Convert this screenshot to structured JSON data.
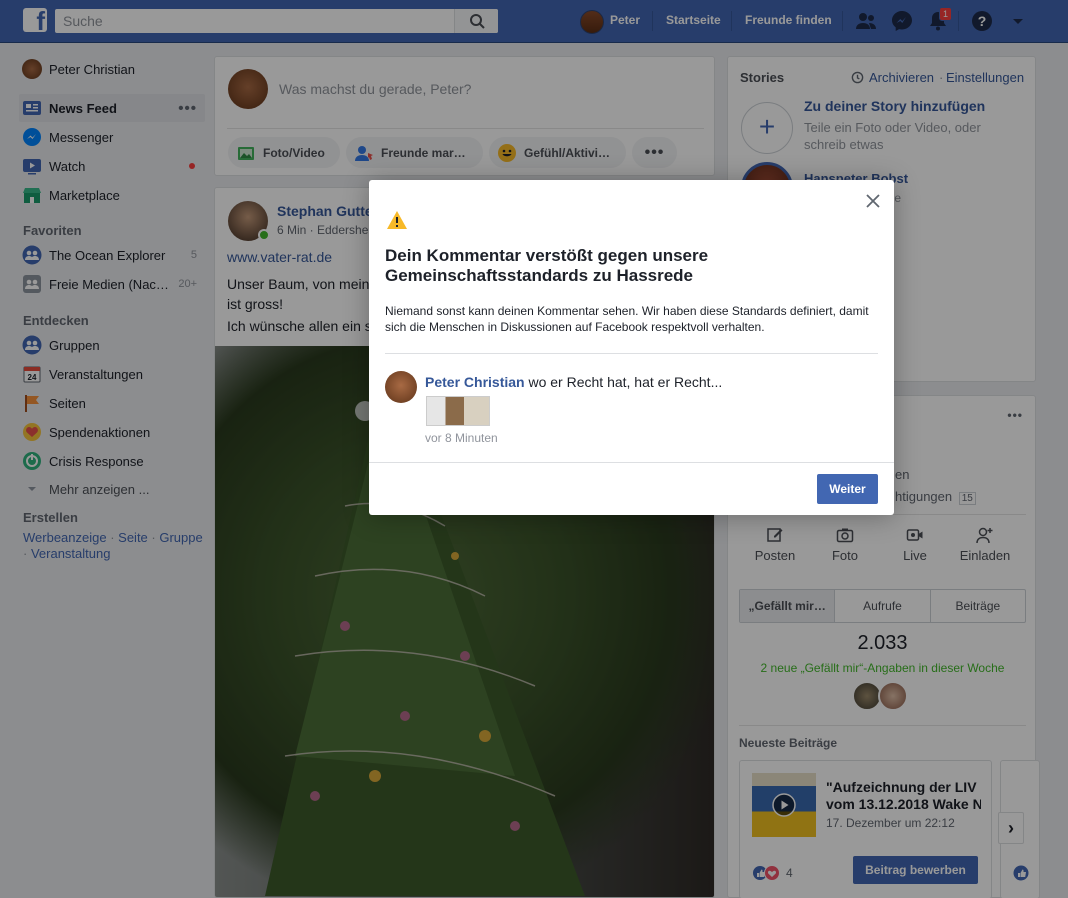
{
  "topbar": {
    "logo": "f",
    "search_placeholder": "Suche",
    "user_name": "Peter",
    "links": [
      "Startseite",
      "Freunde finden"
    ],
    "notif_count": "1"
  },
  "left": {
    "profile_name": "Peter Christian",
    "nav": [
      {
        "label": "News Feed",
        "icon": "news-feed-icon"
      },
      {
        "label": "Messenger",
        "icon": "messenger-icon"
      },
      {
        "label": "Watch",
        "icon": "watch-icon"
      },
      {
        "label": "Marketplace",
        "icon": "marketplace-icon"
      }
    ],
    "favorites_head": "Favoriten",
    "favorites": [
      {
        "label": "The Ocean Explorer",
        "count": "5"
      },
      {
        "label": "Freie Medien (Nac…",
        "count": "20+"
      }
    ],
    "discover_head": "Entdecken",
    "discover": [
      {
        "label": "Gruppen",
        "icon": "groups-icon"
      },
      {
        "label": "Veranstaltungen",
        "icon": "calendar-icon"
      },
      {
        "label": "Seiten",
        "icon": "flag-icon"
      },
      {
        "label": "Spendenaktionen",
        "icon": "heart-icon"
      },
      {
        "label": "Crisis Response",
        "icon": "crisis-icon"
      }
    ],
    "more_label": "Mehr anzeigen ...",
    "create_head": "Erstellen",
    "create_links": [
      "Werbeanzeige",
      "Seite",
      "Gruppe",
      "Veranstaltung"
    ]
  },
  "composer": {
    "placeholder": "Was machst du gerade, Peter?",
    "buttons": [
      "Foto/Video",
      "Freunde mar…",
      "Gefühl/Aktivi…"
    ]
  },
  "post": {
    "author": "Stephan Gutte",
    "meta": "6 Min · Eddershei",
    "link": "www.vater-rat.de",
    "text": "Unser Baum, von mein",
    "text_cont": "ist gross!",
    "text2": "Ich wünsche allen ein s"
  },
  "stories": {
    "title": "Stories",
    "archive": "Archivieren",
    "settings": "Einstellungen",
    "add_title": "Zu deiner Story hinzufügen",
    "add_sub": "Teile ein Foto oder Video, oder schreib etwas",
    "story_name": "Hanspeter Bobst",
    "story_time": "Stunde"
  },
  "page_panel": {
    "partial_1": "en",
    "partial_2": "htigungen",
    "partial_badge": "15",
    "actions": [
      "Posten",
      "Foto",
      "Live",
      "Einladen"
    ],
    "tabs": [
      "„Gefällt mir…",
      "Aufrufe",
      "Beiträge"
    ],
    "likes": "2.033",
    "likes_week": "2 neue „Gefällt mir“-Angaben in dieser Woche",
    "newest_head": "Neueste Beiträge",
    "newest_post": {
      "title_line1": "\"Aufzeichnung der LIV",
      "title_line2": "vom 13.12.2018 Wake N",
      "date": "17. Dezember um 22:12",
      "reactions": "4",
      "button": "Beitrag bewerben"
    }
  },
  "modal": {
    "title": "Dein Kommentar verstößt gegen unsere Gemeinschaftsstandards zu Hassrede",
    "description": "Niemand sonst kann deinen Kommentar sehen. Wir haben diese Standards definiert, damit sich die Menschen in Diskussionen auf Facebook respektvoll verhalten.",
    "comment_author": "Peter Christian",
    "comment_text": "wo er Recht hat, hat er Recht...",
    "comment_time": "vor 8 Minuten",
    "button": "Weiter"
  },
  "colors": {
    "brand": "#4267b2",
    "link": "#365899",
    "warning": "#f7b928",
    "online": "#42b72a"
  }
}
